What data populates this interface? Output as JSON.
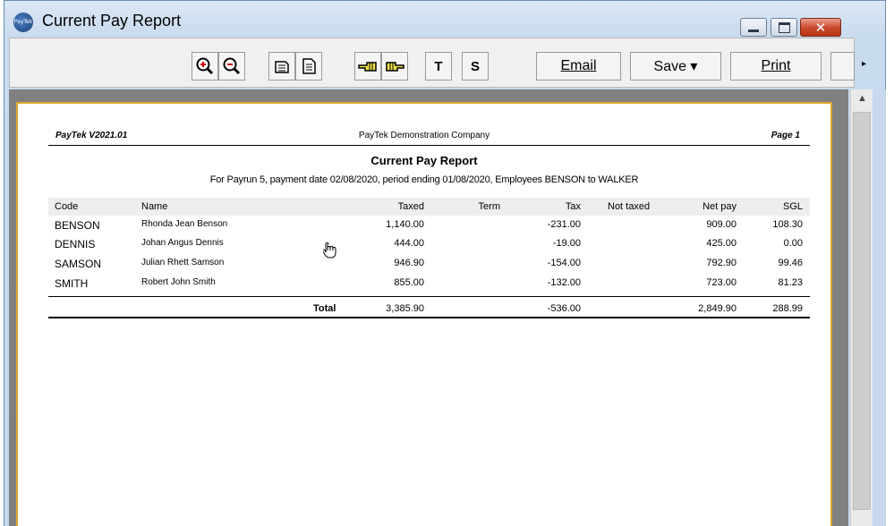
{
  "window": {
    "title": "Current Pay Report",
    "app_icon_text": "PayTek",
    "close_glyph": "✕"
  },
  "toolbar": {
    "t_label": "T",
    "s_label": "S",
    "email_label": "Email",
    "save_label": "Save ▾",
    "print_label": "Print",
    "more_glyph": "▸"
  },
  "scrollbar": {
    "up_glyph": "▲"
  },
  "report": {
    "version": "PayTek V2021.01",
    "company": "PayTek Demonstration Company",
    "page": "Page 1",
    "title": "Current Pay Report",
    "subtitle": "For Payrun 5, payment date 02/08/2020, period ending 01/08/2020, Employees BENSON to WALKER",
    "columns": {
      "code": "Code",
      "name": "Name",
      "taxed": "Taxed",
      "term": "Term",
      "tax": "Tax",
      "not_taxed": "Not taxed",
      "net_pay": "Net pay",
      "sgl": "SGL"
    },
    "rows": [
      {
        "code": "BENSON",
        "name": "Rhonda Jean Benson",
        "taxed": "1,140.00",
        "tax": "-231.00",
        "net_pay": "909.00",
        "sgl": "108.30"
      },
      {
        "code": "DENNIS",
        "name": "Johan Angus Dennis",
        "taxed": "444.00",
        "tax": "-19.00",
        "net_pay": "425.00",
        "sgl": "0.00"
      },
      {
        "code": "SAMSON",
        "name": "Julian Rhett Samson",
        "taxed": "946.90",
        "tax": "-154.00",
        "net_pay": "792.90",
        "sgl": "99.46"
      },
      {
        "code": "SMITH",
        "name": "Robert John Smith",
        "taxed": "855.00",
        "tax": "-132.00",
        "net_pay": "723.00",
        "sgl": "81.23"
      }
    ],
    "total": {
      "label": "Total",
      "taxed": "3,385.90",
      "tax": "-536.00",
      "net_pay": "2,849.90",
      "sgl": "288.99"
    }
  }
}
